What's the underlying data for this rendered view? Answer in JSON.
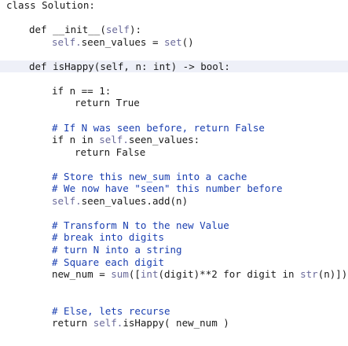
{
  "editor": {
    "lines": [
      {
        "indent": 0,
        "tokens": [
          [
            "kw",
            "class Solution:"
          ]
        ]
      },
      {
        "indent": 0,
        "tokens": []
      },
      {
        "indent": 1,
        "tokens": [
          [
            "kw",
            "def "
          ],
          [
            "fn",
            "__init__"
          ],
          [
            "op",
            "("
          ],
          [
            "self",
            "self"
          ],
          [
            "op",
            "):"
          ]
        ]
      },
      {
        "indent": 2,
        "tokens": [
          [
            "self",
            "self."
          ],
          [
            "fn",
            "seen_values"
          ],
          [
            "op",
            " = "
          ],
          [
            "blt",
            "set"
          ],
          [
            "op",
            "()"
          ]
        ]
      },
      {
        "indent": 0,
        "tokens": []
      },
      {
        "indent": 1,
        "tokens": [
          [
            "kw",
            "def "
          ],
          [
            "fn",
            "isHappy"
          ],
          [
            "op",
            "(self, n: int) -> bool:"
          ]
        ],
        "active": true
      },
      {
        "indent": 0,
        "tokens": []
      },
      {
        "indent": 2,
        "tokens": [
          [
            "kw",
            "if n == 1:"
          ]
        ]
      },
      {
        "indent": 3,
        "tokens": [
          [
            "kw",
            "return True"
          ]
        ]
      },
      {
        "indent": 0,
        "tokens": []
      },
      {
        "indent": 2,
        "tokens": [
          [
            "cm",
            "# If N was seen before, return False"
          ]
        ]
      },
      {
        "indent": 2,
        "tokens": [
          [
            "kw",
            "if n in "
          ],
          [
            "self",
            "self."
          ],
          [
            "fn",
            "seen_values:"
          ]
        ]
      },
      {
        "indent": 3,
        "tokens": [
          [
            "kw",
            "return False"
          ]
        ]
      },
      {
        "indent": 0,
        "tokens": []
      },
      {
        "indent": 2,
        "tokens": [
          [
            "cm",
            "# Store this new_sum into a cache"
          ]
        ]
      },
      {
        "indent": 2,
        "tokens": [
          [
            "cm",
            "# We now have \"seen\" this number before"
          ]
        ]
      },
      {
        "indent": 2,
        "tokens": [
          [
            "self",
            "self."
          ],
          [
            "fn",
            "seen_values.add(n)"
          ]
        ]
      },
      {
        "indent": 0,
        "tokens": []
      },
      {
        "indent": 2,
        "tokens": [
          [
            "cm",
            "# Transform N to the new Value"
          ]
        ]
      },
      {
        "indent": 2,
        "tokens": [
          [
            "cm",
            "# break into digits"
          ]
        ]
      },
      {
        "indent": 2,
        "tokens": [
          [
            "cm",
            "# turn N into a string"
          ]
        ]
      },
      {
        "indent": 2,
        "tokens": [
          [
            "cm",
            "# Square each digit"
          ]
        ]
      },
      {
        "indent": 2,
        "tokens": [
          [
            "kw",
            "new_num = "
          ],
          [
            "blt",
            "sum"
          ],
          [
            "op",
            "(["
          ],
          [
            "blt",
            "int"
          ],
          [
            "op",
            "(digit)**2 for digit in "
          ],
          [
            "blt",
            "str"
          ],
          [
            "op",
            "(n)])"
          ]
        ]
      },
      {
        "indent": 0,
        "tokens": []
      },
      {
        "indent": 0,
        "tokens": []
      },
      {
        "indent": 2,
        "tokens": [
          [
            "cm",
            "# Else, lets recurse"
          ]
        ]
      },
      {
        "indent": 2,
        "tokens": [
          [
            "kw",
            "return "
          ],
          [
            "self",
            "self."
          ],
          [
            "fn",
            "isHappy( new_num )"
          ]
        ]
      }
    ]
  }
}
